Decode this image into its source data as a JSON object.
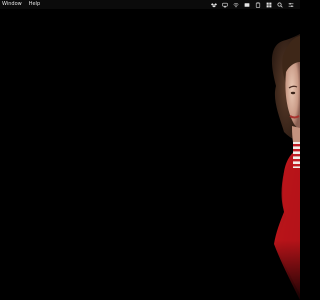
{
  "menubar": {
    "items": [
      {
        "label": "Window"
      },
      {
        "label": "Help"
      }
    ],
    "status_icons": [
      "dropbox-icon",
      "cast-icon",
      "wifi-icon",
      "battery-icon",
      "clipboard-icon",
      "grid-icon",
      "search-icon",
      "control-center-icon"
    ]
  },
  "wallpaper": {
    "background_color": "#000000",
    "accent_color": "#b9141a"
  }
}
